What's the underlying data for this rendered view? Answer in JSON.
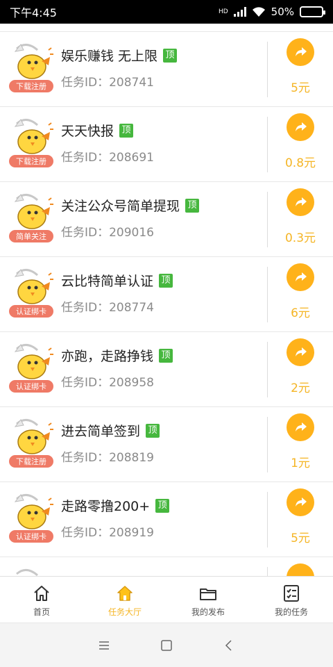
{
  "status_bar": {
    "time": "下午4:45",
    "network": "HD",
    "battery": "50%",
    "battery_level": 0.5
  },
  "task_list": [
    {
      "title": "娱乐赚钱 无上限",
      "badge": "顶",
      "task_id": "任务ID：208741",
      "tag": "下载注册",
      "reward": "5元"
    },
    {
      "title": "天天快报",
      "badge": "顶",
      "task_id": "任务ID：208691",
      "tag": "下载注册",
      "reward": "0.8元"
    },
    {
      "title": "关注公众号简单提现",
      "badge": "顶",
      "task_id": "任务ID：209016",
      "tag": "简单关注",
      "reward": "0.3元"
    },
    {
      "title": "云比特简单认证",
      "badge": "顶",
      "task_id": "任务ID：208774",
      "tag": "认证绑卡",
      "reward": "6元"
    },
    {
      "title": "亦跑，走路挣钱",
      "badge": "顶",
      "task_id": "任务ID：208958",
      "tag": "认证绑卡",
      "reward": "2元"
    },
    {
      "title": "进去简单签到",
      "badge": "顶",
      "task_id": "任务ID：208819",
      "tag": "下载注册",
      "reward": "1元"
    },
    {
      "title": "走路零撸200+",
      "badge": "顶",
      "task_id": "任务ID：208919",
      "tag": "认证绑卡",
      "reward": "5元"
    }
  ],
  "bottom_nav": [
    {
      "label": "首页",
      "icon": "home-icon",
      "active": false
    },
    {
      "label": "任务大厅",
      "icon": "home-icon",
      "active": true
    },
    {
      "label": "我的发布",
      "icon": "folder-icon",
      "active": false
    },
    {
      "label": "我的任务",
      "icon": "checklist-icon",
      "active": false
    }
  ],
  "system_nav": [
    "menu-icon",
    "home-square-icon",
    "back-icon"
  ],
  "colors": {
    "accent": "#f5b525",
    "share_button": "#ffb21a",
    "top_badge": "#46b73e",
    "tag": "#ef7a66"
  }
}
